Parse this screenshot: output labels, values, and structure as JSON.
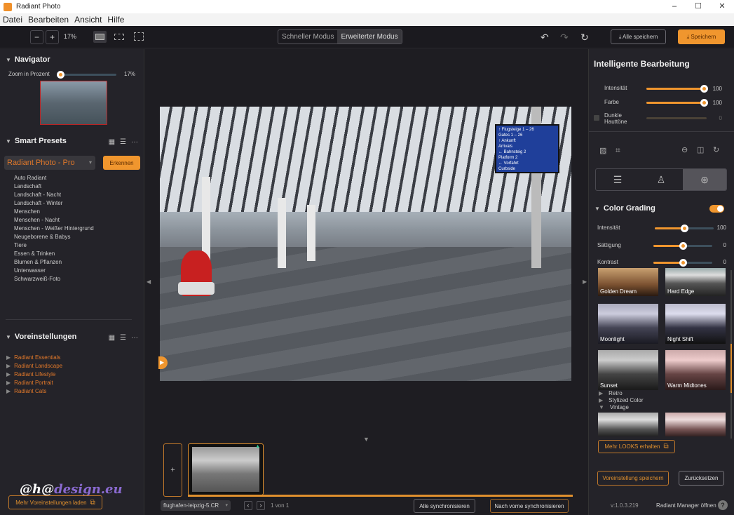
{
  "window": {
    "title": "Radiant Photo",
    "controls": [
      "–",
      "☐",
      "✕"
    ]
  },
  "menu": [
    "Datei",
    "Bearbeiten",
    "Ansicht",
    "Hilfe"
  ],
  "toolbar": {
    "zoom_out": "−",
    "zoom_in": "+",
    "zoom_value": "17%",
    "modes": [
      "Schneller Modus",
      "Erweiterter Modus"
    ],
    "active_mode": "Erweiterter Modus",
    "save_all": "⤓ Alle speichern",
    "save": "⤓ Speichern",
    "undo": "↶",
    "redo": "↷",
    "reset": "↻"
  },
  "left": {
    "navigator": {
      "title": "Navigator",
      "zoom_label": "Zoom in Prozent",
      "zoom_value": "17%",
      "zoom_fraction": 0.02
    },
    "smart_presets": {
      "title": "Smart Presets",
      "selected": "Radiant Photo - Pro",
      "detect_button": "Erkennen",
      "items": [
        "Auto Radiant",
        "Landschaft",
        "Landschaft - Nacht",
        "Landschaft - Winter",
        "Menschen",
        "Menschen - Nacht",
        "Menschen - Weißer Hintergrund",
        "Neugeborene & Babys",
        "Tiere",
        "Essen & Trinken",
        "Blumen & Pflanzen",
        "Unterwasser",
        "Schwarzweiß-Foto"
      ]
    },
    "voreinstellungen": {
      "title": "Voreinstellungen",
      "items": [
        "Radiant Essentials",
        "Radiant Landscape",
        "Radiant Lifestyle",
        "Radiant Portrait",
        "Radiant Cats"
      ]
    },
    "more_presets_button": "Mehr Voreinstellungen laden",
    "watermark": {
      "main": "@h@",
      "accent": "design.eu"
    }
  },
  "center": {
    "sign_lines": [
      "↑ Flugsteige 1 – 26",
      "Gates 1 – 26",
      "↑ Ankunft",
      "Arrivals",
      "← Bahnsteig 2",
      "Platform 2",
      "← Vorfahrt",
      "Curbside"
    ],
    "filmstrip_add": "+",
    "file_name": "flughafen-leipzig-5.CR",
    "page_prev": "‹",
    "page_next": "›",
    "page_info": "1 von 1",
    "sync_all": "Alle synchronisieren",
    "sync_forward": "Nach vorne synchronisieren"
  },
  "right": {
    "title": "Intelligente Bearbeitung",
    "sliders": [
      {
        "label": "Intensität",
        "value": "100",
        "fraction": 1.0
      },
      {
        "label": "Farbe",
        "value": "100",
        "fraction": 1.0
      }
    ],
    "dark_skin": {
      "label1": "Dunkle",
      "label2": "Hauttöne",
      "value": "0",
      "checked": false
    },
    "color_grading": {
      "title": "Color Grading",
      "enabled": true,
      "sliders": [
        {
          "label": "Intensität",
          "value": "100",
          "fraction": 0.5
        },
        {
          "label": "Sättigung",
          "value": "0",
          "fraction": 0.5
        },
        {
          "label": "Kontrast",
          "value": "0",
          "fraction": 0.5
        }
      ],
      "looks": [
        "Golden Dream",
        "Hard Edge",
        "Moonlight",
        "Night Shift",
        "Sunset",
        "Warm Midtones"
      ],
      "groups": [
        {
          "label": "Retro",
          "expanded": false
        },
        {
          "label": "Stylized Color",
          "expanded": false
        },
        {
          "label": "Vintage",
          "expanded": true
        }
      ]
    },
    "more_looks": "Mehr LOOKS erhalten",
    "save_preset": "Voreinstellung speichern",
    "reset": "Zurücksetzen",
    "version": "v:1.0.3.219",
    "manager": "Radiant Manager öffnen",
    "help": "?"
  },
  "colors": {
    "accent": "#f0962e",
    "preset_link": "#e0782a",
    "bg": "#1e1d22",
    "panel": "#242329"
  }
}
